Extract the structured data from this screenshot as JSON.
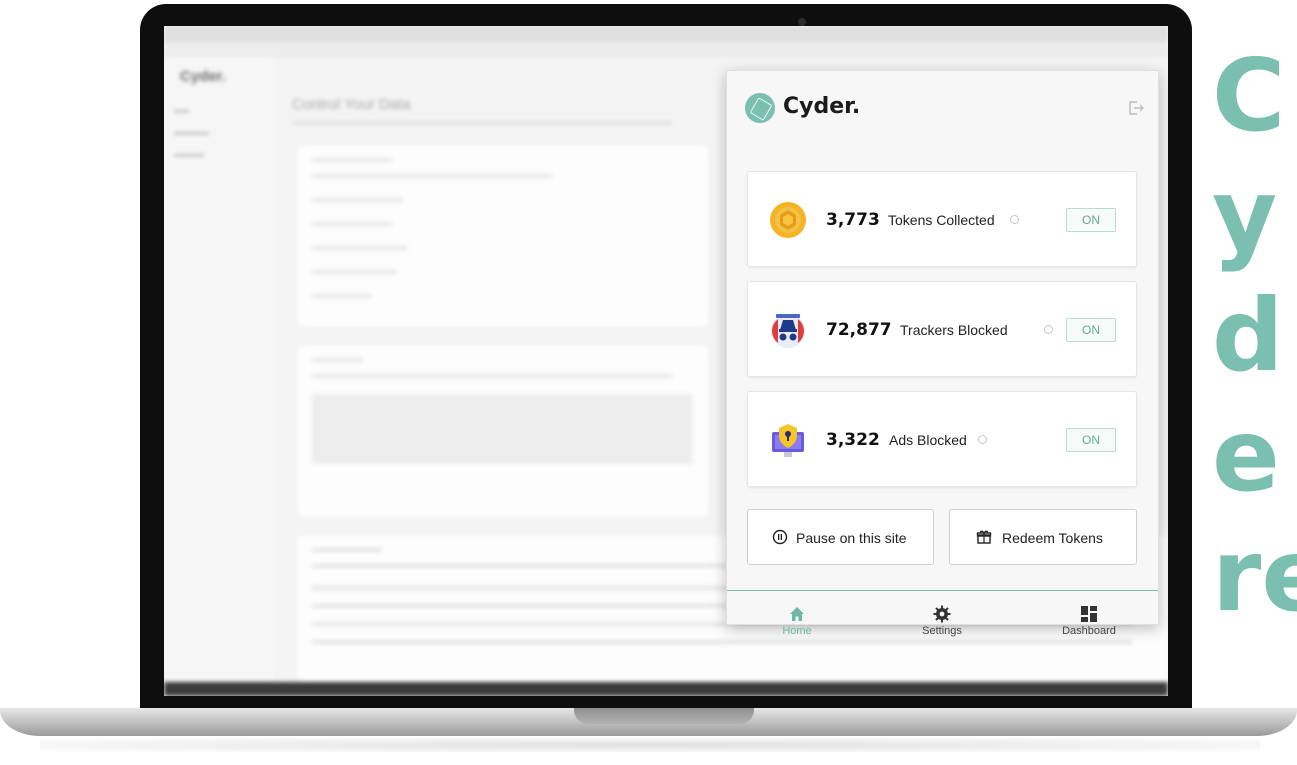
{
  "popup": {
    "brand": "Cyder.",
    "stats": [
      {
        "value": "3,773",
        "label": "Tokens Collected",
        "toggle": "ON",
        "icon": "token-icon"
      },
      {
        "value": "72,877",
        "label": "Trackers Blocked",
        "toggle": "ON",
        "icon": "tracker-spy-icon"
      },
      {
        "value": "3,322",
        "label": "Ads Blocked",
        "toggle": "ON",
        "icon": "ad-shield-icon"
      }
    ],
    "actions": {
      "pause_label": "Pause on this site",
      "redeem_label": "Redeem Tokens"
    },
    "nav": {
      "home": "Home",
      "settings": "Settings",
      "dashboard": "Dashboard"
    }
  },
  "background_page": {
    "logo": "Cyder.",
    "title": "Control Your Data"
  },
  "headline": {
    "lines": [
      "C",
      "y",
      "d",
      "e",
      "re"
    ]
  },
  "colors": {
    "accent": "#7bbfb0",
    "token_gold": "#f2b01e",
    "text_dark": "#111111"
  }
}
